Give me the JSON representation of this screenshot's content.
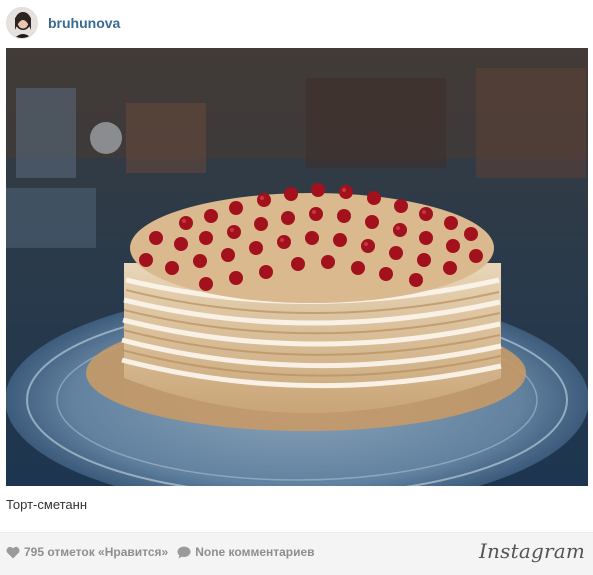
{
  "post": {
    "username": "bruhunova",
    "caption": "Торт-сметанн",
    "likes_text": "795 отметок «Нравится»",
    "comments_text": "None комментариев",
    "brand": "Instagram"
  },
  "icons": {
    "heart": "heart-icon",
    "comment": "comment-bubble-icon"
  },
  "colors": {
    "username": "#3a6a94",
    "meta_text": "#8e8e8e",
    "footer_bg": "#f4f4f4"
  }
}
